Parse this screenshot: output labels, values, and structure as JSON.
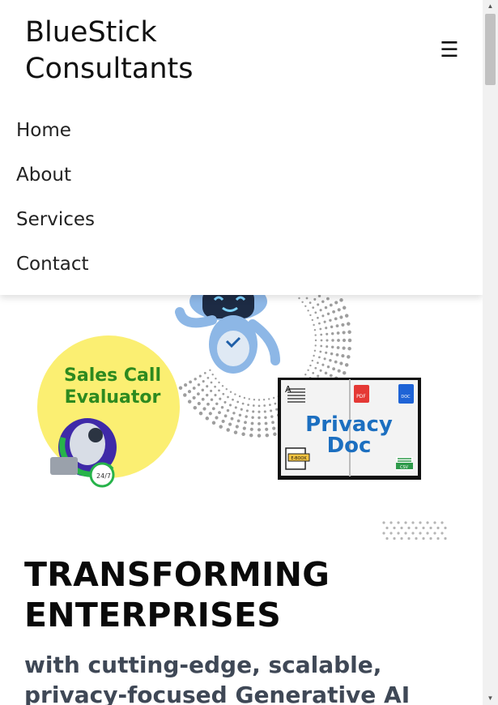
{
  "header": {
    "brand_line1": "BlueStick",
    "brand_line2": "Consultants",
    "menu_icon": "hamburger-icon",
    "menu_glyph": "☰"
  },
  "nav": {
    "items": [
      {
        "label": "Home"
      },
      {
        "label": "About"
      },
      {
        "label": "Services"
      },
      {
        "label": "Contact"
      }
    ]
  },
  "hero": {
    "badge_line1": "Sales Call",
    "badge_line2": "Evaluator",
    "badge_247": "24/7",
    "book_title_line1": "Privacy",
    "book_title_line2": "Doc",
    "pdf_label": "PDF",
    "doc_label": "DOC",
    "ebook_label": "E-BOOK",
    "csv_label": "CSV",
    "book_letter": "A",
    "headline_line1": "TRANSFORMING",
    "headline_line2": "ENTERPRISES",
    "subheadline": "with cutting-edge, scalable, privacy-focused Generative AI Solutions"
  },
  "colors": {
    "badge_yellow": "#fbef72",
    "badge_green": "#2d8a1f",
    "book_blue": "#1c6fc0",
    "robot_blue": "#8db7e6",
    "subheadline_gray": "#3f4856"
  }
}
